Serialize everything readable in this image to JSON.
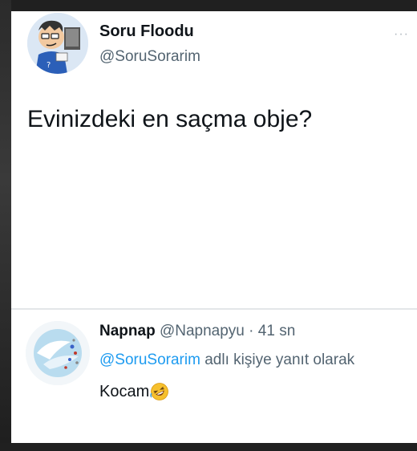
{
  "tweet": {
    "author_name": "Soru Floodu",
    "author_handle": "@SoruSorarim",
    "text": "Evinizdeki en saçma obje?"
  },
  "reply": {
    "author_name": "Napnap",
    "author_handle": "@Napnapyu",
    "separator": "·",
    "time": "41 sn",
    "mention": "@SoruSorarim",
    "reply_suffix": "adlı kişiye yanıt olarak",
    "text": "Kocam",
    "emoji": "rolling-on-floor-laughing-emoji"
  },
  "colors": {
    "background": "#ffffff",
    "text_primary": "#0f1419",
    "text_secondary": "#536471",
    "accent": "#1d9bf0"
  },
  "icons": [
    "more-dots-icon",
    "avatar-cartoon",
    "avatar-abstract"
  ]
}
